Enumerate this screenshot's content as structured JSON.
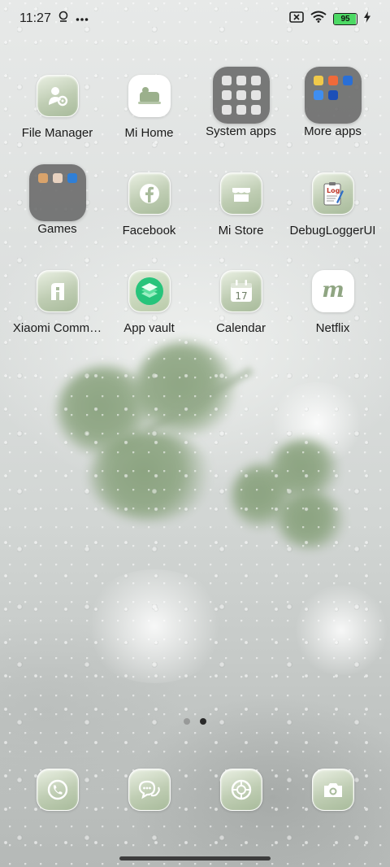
{
  "status_bar": {
    "time": "11:27",
    "battery_level": "95",
    "battery_fraction": 0.95,
    "icons": [
      "location-pin-icon",
      "more-dots-icon",
      "sim-x-icon",
      "wifi-icon",
      "battery-icon",
      "charging-bolt-icon"
    ]
  },
  "apps": [
    {
      "label": "File Manager",
      "icon": "file-manager-icon"
    },
    {
      "label": "Mi Home",
      "icon": "mi-home-icon"
    },
    {
      "label": "System apps",
      "icon": "folder-icon"
    },
    {
      "label": "More apps",
      "icon": "folder-icon"
    },
    {
      "label": "Games",
      "icon": "folder-icon"
    },
    {
      "label": "Facebook",
      "icon": "facebook-icon"
    },
    {
      "label": "Mi Store",
      "icon": "store-icon"
    },
    {
      "label": "DebugLoggerUI",
      "icon": "log-clipboard-icon"
    },
    {
      "label": "Xiaomi Comm…",
      "icon": "community-icon"
    },
    {
      "label": "App vault",
      "icon": "layers-icon"
    },
    {
      "label": "Calendar",
      "icon": "calendar-icon"
    },
    {
      "label": "Netflix",
      "icon": "netflix-icon"
    }
  ],
  "calendar_day": "17",
  "netflix_letter": "m",
  "debug_log_text": "Log",
  "pages": {
    "count": 2,
    "active": 2
  },
  "dock": [
    {
      "icon": "phone-icon"
    },
    {
      "icon": "messages-icon"
    },
    {
      "icon": "browser-icon"
    },
    {
      "icon": "camera-icon"
    }
  ],
  "colors": {
    "icon_tint": "#a8bb9b",
    "folder_bg": "#646464",
    "battery_fill": "#4cd964"
  }
}
